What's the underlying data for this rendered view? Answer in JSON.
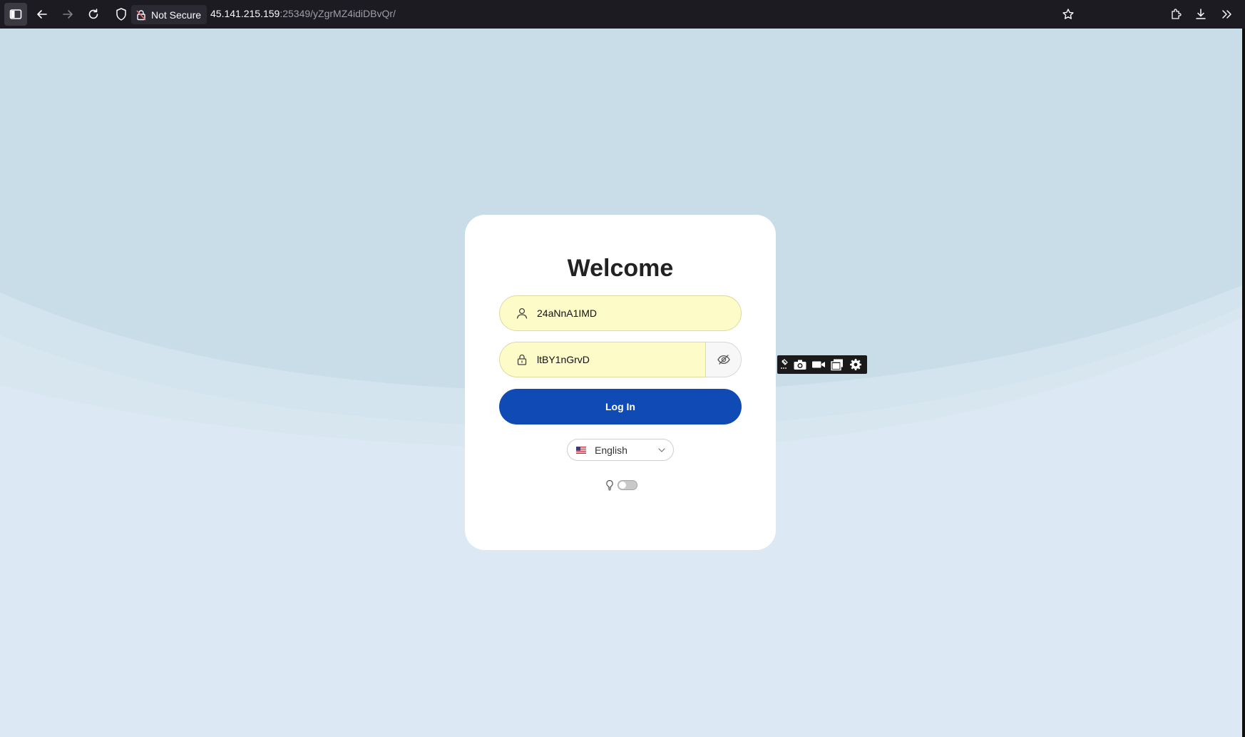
{
  "browser": {
    "security_label": "Not Secure",
    "url_host": "45.141.215.159",
    "url_rest": ":25349/yZgrMZ4idiDBvQr/"
  },
  "login": {
    "title": "Welcome",
    "username_value": "24aNnA1IMD",
    "password_value": "ltBY1nGrvD",
    "login_label": "Log In",
    "language": "English"
  },
  "theme_toggle": {
    "state": "off"
  },
  "colors": {
    "primary_button": "#0f4ab5",
    "autofill_background": "#fdfbc8",
    "page_background": "#dce8f3"
  }
}
